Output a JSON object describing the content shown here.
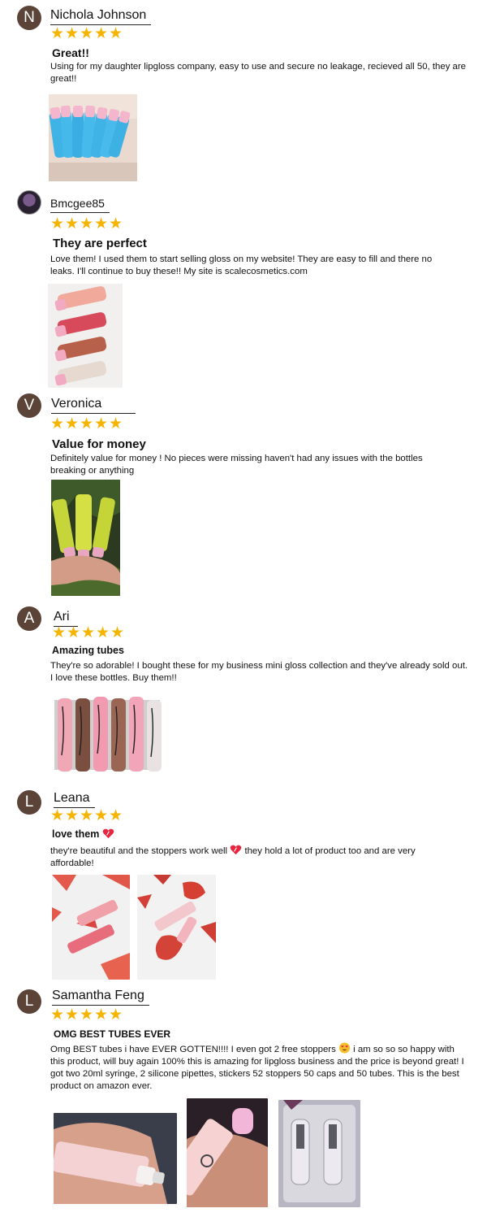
{
  "reviews": [
    {
      "avatar_letter": "N",
      "name": "Nichola Johnson",
      "rating": 5,
      "title": "Great!!",
      "text": "Using for my daughter lipgloss company, easy to use and secure no leakage, recieved all 50, they are great!!"
    },
    {
      "avatar_letter": "",
      "name": "Bmcgee85",
      "rating": 5,
      "title": "They are perfect",
      "text": "Love them! I used them to start selling gloss on my website! They are easy to fill and there no leaks. I'll continue to buy these!! My site is scalecosmetics.com"
    },
    {
      "avatar_letter": "V",
      "name": "Veronica",
      "rating": 5,
      "title": "Value for money",
      "text": "Definitely value for money ! No pieces were missing haven't had any issues with the bottles breaking or anything"
    },
    {
      "avatar_letter": "A",
      "name": "Ari",
      "rating": 5,
      "title": "Amazing tubes",
      "text": "They're so adorable! I bought these for my business mini gloss collection and they've already sold out. I love these bottles. Buy them!!"
    },
    {
      "avatar_letter": "L",
      "name": "Leana",
      "rating": 5,
      "title": "love them",
      "text_before": "they're beautiful and the stoppers work well",
      "text_after": "they hold a lot of product too and are very affordable!"
    },
    {
      "avatar_letter": "L",
      "name": "Samantha Feng",
      "rating": 5,
      "title": "OMG BEST TUBES EVER",
      "text_before": "Omg BEST tubes i have EVER GOTTEN!!!! I even got 2 free stoppers",
      "text_after": "i am so so so happy with this product, will buy again 100% this is amazing for lipgloss business and the price is beyond great! I got two 20ml syringe, 2 silicone pipettes, stickers 52 stoppers 50 caps and 50 tubes. This is the best product on amazon ever."
    }
  ],
  "star_glyph": "★",
  "colors": {
    "star": "#f4b400",
    "avatar_bg": "#5b4338"
  },
  "icons": {
    "heart_emoji": "sparkling-heart-icon",
    "smile_emoji": "heart-eyes-icon"
  }
}
